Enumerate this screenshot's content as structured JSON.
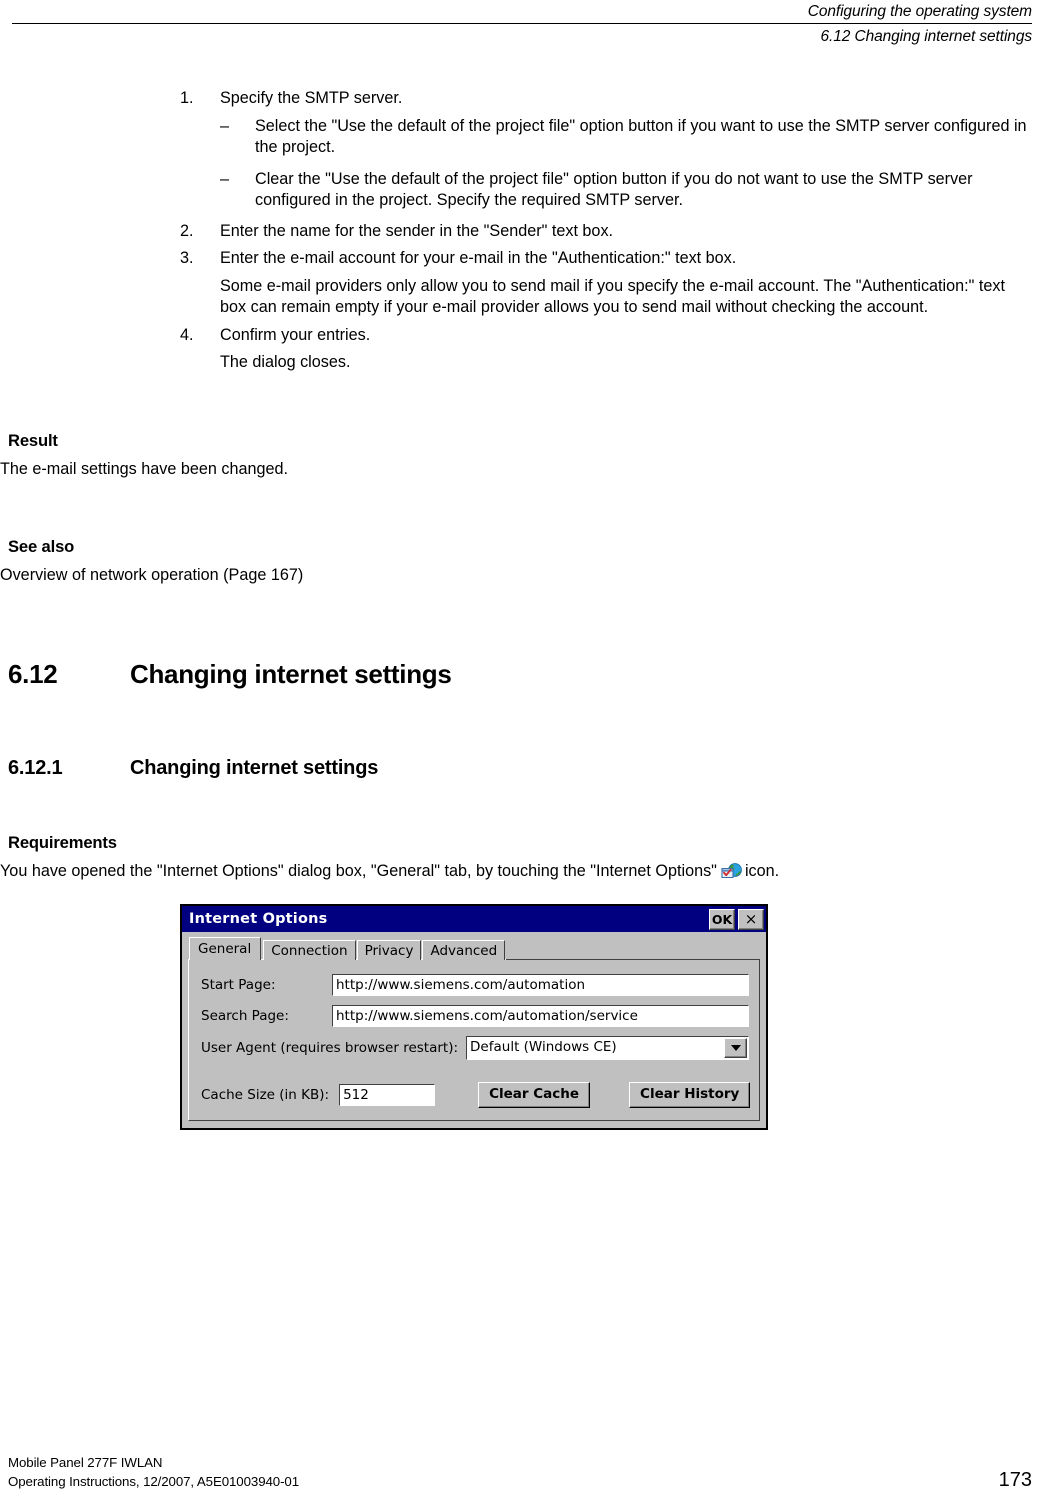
{
  "header": {
    "chapter_title": "Configuring the operating system",
    "section_title": "6.12 Changing internet settings"
  },
  "steps": [
    {
      "num": "1.",
      "text": "Specify the SMTP server.",
      "sub_items": [
        {
          "dash": "–",
          "text": "Select the \"Use the default of the project file\" option button if you want to use the SMTP server configured in the project."
        },
        {
          "dash": "–",
          "text": "Clear the \"Use the default of the project file\" option button if you do not want to use the SMTP server configured in the project. Specify the required SMTP server."
        }
      ]
    },
    {
      "num": "2.",
      "text": "Enter the name for the sender in the \"Sender\" text box."
    },
    {
      "num": "3.",
      "text": "Enter the e-mail account for your e-mail in the \"Authentication:\" text box.",
      "note": "Some e-mail providers only allow you to send mail if you specify the e-mail account. The \"Authentication:\" text box can remain empty if your e-mail provider allows you to send mail without checking the account."
    },
    {
      "num": "4.",
      "text": "Confirm your entries.",
      "note": "The dialog closes."
    }
  ],
  "result": {
    "heading": "Result",
    "body": "The e-mail settings have been changed."
  },
  "see_also": {
    "heading": "See also",
    "link": "Overview of network operation (Page 167)"
  },
  "section": {
    "number": "6.12",
    "title": "Changing internet settings"
  },
  "subsection": {
    "number": "6.12.1",
    "title": "Changing internet settings"
  },
  "requirements": {
    "heading": "Requirements",
    "text_before_icon": "You have opened the \"Internet Options\" dialog box, \"General\" tab, by touching the \"Internet Options\"",
    "icon_name": "internet-options-icon",
    "text_after_icon": "icon."
  },
  "dialog": {
    "title": "Internet Options",
    "ok_label": "OK",
    "close_label": "×",
    "tabs": [
      {
        "label": "General",
        "active": true
      },
      {
        "label": "Connection",
        "active": false
      },
      {
        "label": "Privacy",
        "active": false
      },
      {
        "label": "Advanced",
        "active": false
      }
    ],
    "fields": {
      "start_page_label": "Start Page:",
      "start_page_value": "http://www.siemens.com/automation",
      "search_page_label": "Search Page:",
      "search_page_value": "http://www.siemens.com/automation/service",
      "user_agent_label": "User Agent (requires browser restart):",
      "user_agent_value": "Default (Windows CE)",
      "cache_size_label": "Cache Size (in KB):",
      "cache_size_value": "512"
    },
    "buttons": {
      "clear_cache": "Clear Cache",
      "clear_history": "Clear History"
    }
  },
  "footer": {
    "line1": "Mobile Panel 277F IWLAN",
    "line2": "Operating Instructions, 12/2007, A5E01003940-01",
    "page_number": "173"
  }
}
